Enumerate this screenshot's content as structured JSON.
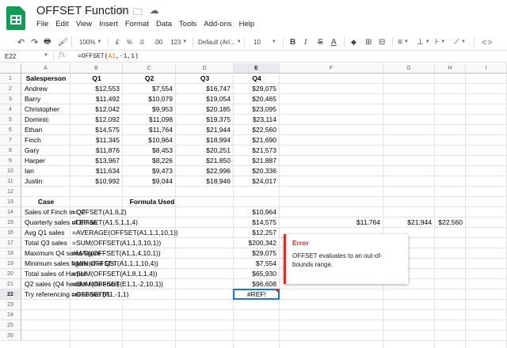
{
  "app": {
    "title": "OFFSET Function"
  },
  "title_icons": [
    "star-icon",
    "move-to-folder-icon",
    "cloud-saved-icon"
  ],
  "menu": [
    "File",
    "Edit",
    "View",
    "Insert",
    "Format",
    "Data",
    "Tools",
    "Add-ons",
    "Help"
  ],
  "toolbar": {
    "undo": "↶",
    "redo": "↷",
    "print": "🖶",
    "paint": "🖌",
    "zoom": "100%",
    "currency": "£",
    "percent": "%",
    "dec_less": ".0",
    "dec_more": ".00",
    "more_formats": "123",
    "font": "Default (Ari...",
    "font_size": "10",
    "bold": "B",
    "italic": "I",
    "strike": "S",
    "text_color": "A",
    "fill": "◆",
    "borders": "⊞",
    "merge": "⊟",
    "halign": "≡",
    "valign": "⊥",
    "wrap": "⊦",
    "rotate": "⟋",
    "link": "⊂⊃"
  },
  "formula_bar": {
    "name_box": "E22",
    "fx": "fx",
    "formula": "=OFFSET(A1,-1,1)"
  },
  "columns": [
    "A",
    "B",
    "C",
    "D",
    "E",
    "F",
    "G",
    "H",
    "I"
  ],
  "rows": [
    "1",
    "2",
    "3",
    "4",
    "5",
    "6",
    "7",
    "8",
    "9",
    "10",
    "11",
    "12",
    "13",
    "14",
    "15",
    "16",
    "17",
    "18",
    "19",
    "20",
    "21",
    "22",
    "23",
    "24",
    "25",
    "26"
  ],
  "header_row": [
    "Salesperson",
    "Q1",
    "Q2",
    "Q3",
    "Q4"
  ],
  "sales": [
    [
      "Andrew",
      "$12,553",
      "$7,554",
      "$16,747",
      "$29,075"
    ],
    [
      "Barry",
      "$11,492",
      "$10,079",
      "$19,054",
      "$20,465"
    ],
    [
      "Christopher",
      "$12,042",
      "$9,953",
      "$20,185",
      "$23,095"
    ],
    [
      "Dominic",
      "$12,092",
      "$11,098",
      "$19,375",
      "$23,114"
    ],
    [
      "Ethan",
      "$14,575",
      "$11,764",
      "$21,944",
      "$22,560"
    ],
    [
      "Finch",
      "$11,345",
      "$10,964",
      "$18,994",
      "$21,690"
    ],
    [
      "Gary",
      "$11,876",
      "$8,453",
      "$20,251",
      "$21,573"
    ],
    [
      "Harper",
      "$13,967",
      "$8,226",
      "$21,850",
      "$21,887"
    ],
    [
      "Ian",
      "$11,634",
      "$9,473",
      "$22,996",
      "$20,336"
    ],
    [
      "Justin",
      "$10,992",
      "$9,044",
      "$18,946",
      "$24,017"
    ]
  ],
  "cases_header": {
    "case": "Case",
    "formula": "Formula Used"
  },
  "cases": [
    {
      "case": "Sales of Finch in Q2",
      "formula": "=OFFSET(A1,6,2)",
      "result": "$10,964"
    },
    {
      "case": "Quarterly sales of Ethan",
      "formula": "=OFFSET(A1,5,1,1,4)",
      "result": "$14,575"
    },
    {
      "case": "Avg Q1 sales",
      "formula": "=AVERAGE(OFFSET(A1,1,1,10,1))",
      "result": "$12,257"
    },
    {
      "case": "Total Q3 sales",
      "formula": "=SUM(OFFSET(A1,1,3,10,1))",
      "result": "$200,342"
    },
    {
      "case": "Maximum Q4 sales figure",
      "formula": "=MAX(OFFSET(A1,1,4,10,1))",
      "result": "$29,075"
    },
    {
      "case": "Minimum sales figure of al Q's",
      "formula": "=MIN(OFFSET(A1,1,1,10,4))",
      "result": "$7,554"
    },
    {
      "case": "Total sales of Harper",
      "formula": "=SUM(OFFSET(A1,8,1,1,4))",
      "result": "$65,930"
    },
    {
      "case": "Q2 sales (Q4 header reference)",
      "formula": "=SUM(OFFSET(E1,1,-2,10,1))",
      "result": "$96,608"
    },
    {
      "case": "Try referencing cel above B1",
      "formula": "=OFFSET(A1,-1,1)",
      "result": "#REF!"
    }
  ],
  "spill_row15": [
    "$11,764",
    "$21,944",
    "$22,560"
  ],
  "error_tooltip": {
    "title": "Error",
    "message": "OFFSET evaluates to an out-of-bounds range."
  }
}
